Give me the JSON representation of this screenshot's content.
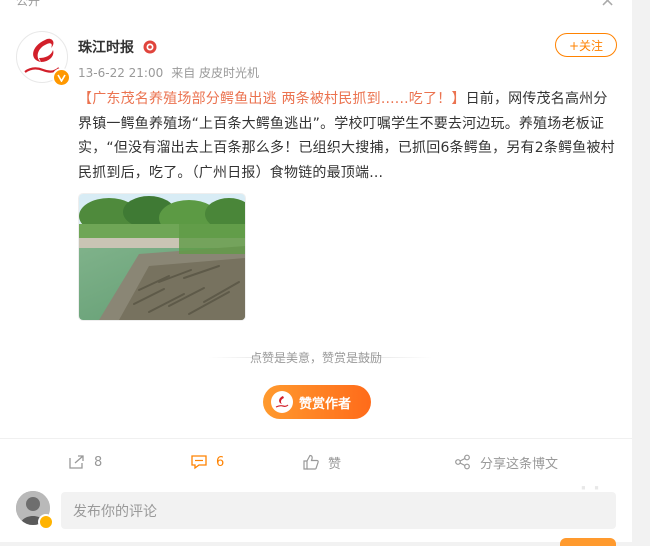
{
  "page": {
    "top_label": "公开",
    "close_glyph": "×"
  },
  "post": {
    "author": "珠江时报",
    "time": "13-6-22 21:00",
    "source": "来自 皮皮时光机",
    "follow_label": "+关注",
    "text_link": "【广东茂名养殖场部分鳄鱼出逃 两条被村民抓到......吃了！】",
    "text_body": "日前，网传茂名高州分界镇一鳄鱼养殖场“上百条大鳄鱼逃出”。学校叮嘱学生不要去河边玩。养殖场老板证实，“但没有溜出去上百条那么多！已组织大搜捕，已抓回6条鳄鱼，另有2条鳄鱼被村民抓到后，吃了。（广州日报）食物链的最顶端...",
    "avatar_text": "珠江时报"
  },
  "reward": {
    "slogan": "点赞是美意，赞赏是鼓励",
    "button_label": "赞赏作者"
  },
  "actions": {
    "repost_count": "8",
    "comment_count": "6",
    "like_label": "赞",
    "share_label": "分享这条博文"
  },
  "comment_box": {
    "placeholder": "发布你的评论"
  },
  "colors": {
    "accent": "#ff8200",
    "link": "#eb7350"
  }
}
